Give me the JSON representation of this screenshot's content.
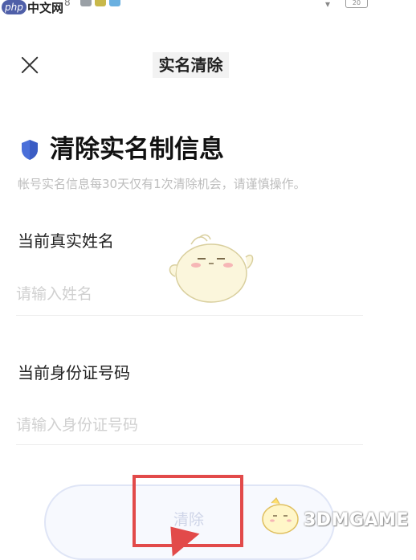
{
  "status_bar": {
    "site_logo": "php",
    "site_name": "中文网",
    "left_number": "8",
    "battery": "20"
  },
  "nav": {
    "title": "实名清除"
  },
  "main": {
    "heading": "清除实名制信息",
    "notice": "帐号实名信息每30天仅有1次清除机会，请谨慎操作。",
    "name_field": {
      "label": "当前真实姓名",
      "placeholder": "请输入姓名",
      "value": ""
    },
    "id_field": {
      "label": "当前身份证号码",
      "placeholder": "请输入身份证号码",
      "value": ""
    },
    "submit_label": "清除"
  },
  "watermark": {
    "text": "3DMGAME"
  },
  "colors": {
    "shield": "#4a6fd9",
    "highlight": "#e24a4a",
    "button_border": "#dfe5f6",
    "placeholder": "#d0d0d0"
  }
}
